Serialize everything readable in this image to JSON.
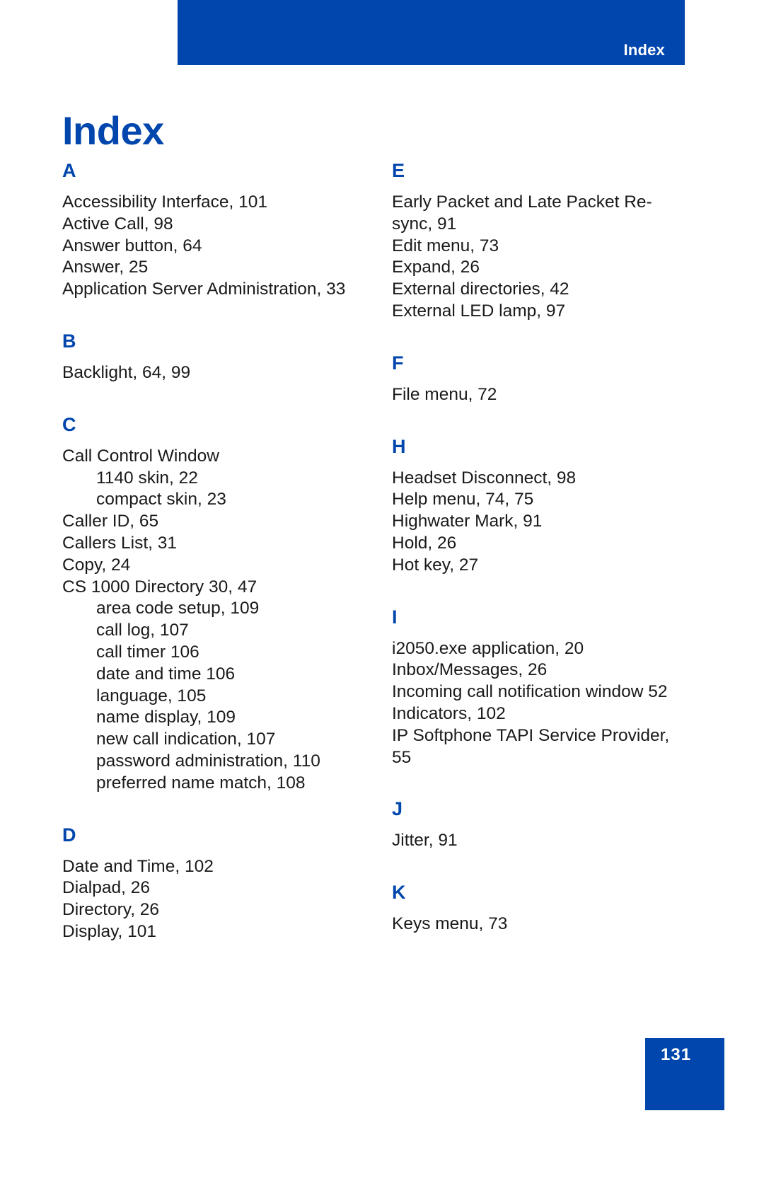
{
  "header": {
    "running_head": "Index"
  },
  "page_title": "Index",
  "colors": {
    "accent_blue": "#0046ad",
    "text_black": "#1a1a1a",
    "page_white": "#ffffff"
  },
  "footer": {
    "page_number": "131"
  },
  "columns": [
    {
      "id": "left-column",
      "groups": [
        {
          "letter": "A",
          "entries": [
            {
              "text": "Accessibility Interface, 101",
              "level": 0
            },
            {
              "text": "Active Call, 98",
              "level": 0
            },
            {
              "text": "Answer button, 64",
              "level": 0
            },
            {
              "text": "Answer, 25",
              "level": 0
            },
            {
              "text": "Application Server Administration, 33",
              "level": 0
            }
          ]
        },
        {
          "letter": "B",
          "entries": [
            {
              "text": "Backlight, 64, 99",
              "level": 0
            }
          ]
        },
        {
          "letter": "C",
          "entries": [
            {
              "text": "Call Control Window",
              "level": 0
            },
            {
              "text": "1140 skin, 22",
              "level": 1
            },
            {
              "text": "compact skin, 23",
              "level": 1
            },
            {
              "text": "Caller ID, 65",
              "level": 0
            },
            {
              "text": "Callers List, 31",
              "level": 0
            },
            {
              "text": "Copy, 24",
              "level": 0
            },
            {
              "text": "CS 1000 Directory 30, 47",
              "level": 0
            },
            {
              "text": "area code setup, 109",
              "level": 1
            },
            {
              "text": "call log, 107",
              "level": 1
            },
            {
              "text": "call timer 106",
              "level": 1
            },
            {
              "text": "date and time 106",
              "level": 1
            },
            {
              "text": "language, 105",
              "level": 1
            },
            {
              "text": "name display, 109",
              "level": 1
            },
            {
              "text": "new call indication, 107",
              "level": 1
            },
            {
              "text": "password administration, 110",
              "level": 1
            },
            {
              "text": "preferred name match, 108",
              "level": 1
            }
          ]
        },
        {
          "letter": "D",
          "entries": [
            {
              "text": "Date and Time, 102",
              "level": 0
            },
            {
              "text": "Dialpad, 26",
              "level": 0
            },
            {
              "text": "Directory, 26",
              "level": 0
            },
            {
              "text": "Display, 101",
              "level": 0
            }
          ]
        }
      ]
    },
    {
      "id": "right-column",
      "groups": [
        {
          "letter": "E",
          "entries": [
            {
              "text": "Early Packet and Late Packet Re-sync, 91",
              "level": 0
            },
            {
              "text": "Edit menu, 73",
              "level": 0
            },
            {
              "text": "Expand, 26",
              "level": 0
            },
            {
              "text": "External directories, 42",
              "level": 0
            },
            {
              "text": "External LED lamp, 97",
              "level": 0
            }
          ]
        },
        {
          "letter": "F",
          "entries": [
            {
              "text": "File menu, 72",
              "level": 0
            }
          ]
        },
        {
          "letter": "H",
          "entries": [
            {
              "text": "Headset Disconnect, 98",
              "level": 0
            },
            {
              "text": "Help menu, 74, 75",
              "level": 0
            },
            {
              "text": "Highwater Mark, 91",
              "level": 0
            },
            {
              "text": "Hold, 26",
              "level": 0
            },
            {
              "text": "Hot key, 27",
              "level": 0
            }
          ]
        },
        {
          "letter": "I",
          "entries": [
            {
              "text": "i2050.exe application, 20",
              "level": 0
            },
            {
              "text": "Inbox/Messages, 26",
              "level": 0
            },
            {
              "text": "Incoming call notification window 52",
              "level": 0
            },
            {
              "text": "Indicators, 102",
              "level": 0
            },
            {
              "text": "IP Softphone TAPI Service Provider, 55",
              "level": 0
            }
          ]
        },
        {
          "letter": "J",
          "entries": [
            {
              "text": "Jitter, 91",
              "level": 0
            }
          ]
        },
        {
          "letter": "K",
          "entries": [
            {
              "text": "Keys menu, 73",
              "level": 0
            }
          ]
        }
      ]
    }
  ]
}
